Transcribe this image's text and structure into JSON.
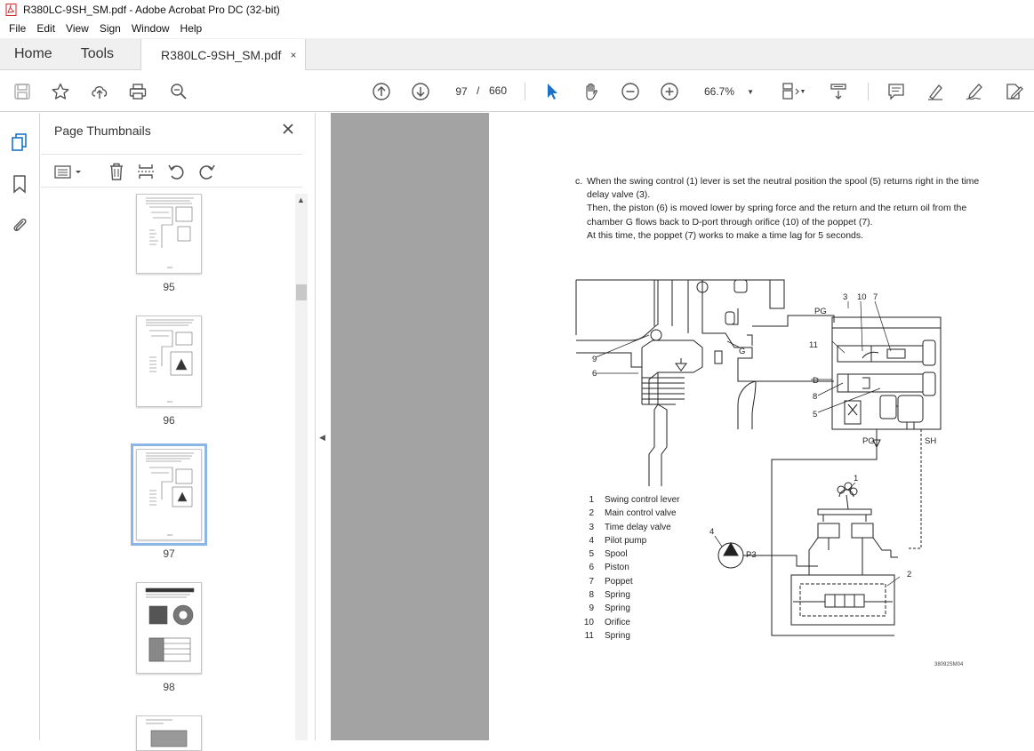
{
  "window": {
    "title": "R380LC-9SH_SM.pdf - Adobe Acrobat Pro DC (32-bit)"
  },
  "menu": [
    "File",
    "Edit",
    "View",
    "Sign",
    "Window",
    "Help"
  ],
  "tabs": {
    "home": "Home",
    "tools": "Tools",
    "document": "R380LC-9SH_SM.pdf",
    "close": "×"
  },
  "toolbar": {
    "page_current": "97",
    "page_sep": "/",
    "page_total": "660",
    "zoom": "66.7%"
  },
  "thumbnails": {
    "title": "Page Thumbnails",
    "pages": [
      {
        "label": "95"
      },
      {
        "label": "96"
      },
      {
        "label": "97",
        "selected": true
      },
      {
        "label": "98"
      }
    ]
  },
  "document": {
    "paragraph": {
      "marker": "c.",
      "lines": [
        "When the swing control (1) lever is set the neutral position the spool (5) returns right in the time",
        "delay valve (3).",
        "Then, the piston (6) is moved lower by spring force and the return and the return oil from the",
        "chamber G flows back to D-port through orifice (10) of the poppet (7).",
        "At this time, the poppet (7) works to make a time lag for 5 seconds."
      ]
    },
    "diagram_labels": {
      "pg_top": "PG",
      "g": "G",
      "d": "D",
      "pg_bottom": "PG",
      "sh": "SH",
      "p3": "P3",
      "n3": "3",
      "n10": "10",
      "n7": "7",
      "n11": "11",
      "n8": "8",
      "n5": "5",
      "n9": "9",
      "n6": "6",
      "n1": "1",
      "n4": "4",
      "n2": "2"
    },
    "legend": [
      {
        "num": "1",
        "text": "Swing control lever"
      },
      {
        "num": "2",
        "text": "Main control valve"
      },
      {
        "num": "3",
        "text": "Time delay valve"
      },
      {
        "num": "4",
        "text": "Pilot pump"
      },
      {
        "num": "5",
        "text": "Spool"
      },
      {
        "num": "6",
        "text": "Piston"
      },
      {
        "num": "7",
        "text": "Poppet"
      },
      {
        "num": "8",
        "text": "Spring"
      },
      {
        "num": "9",
        "text": "Spring"
      },
      {
        "num": "10",
        "text": "Orifice"
      },
      {
        "num": "11",
        "text": "Spring"
      }
    ],
    "figure_code": "38092SM04"
  },
  "colors": {
    "accent_blue": "#1a73c8",
    "selection": "#8bb6e6",
    "canvas": "#a3a3a3"
  }
}
